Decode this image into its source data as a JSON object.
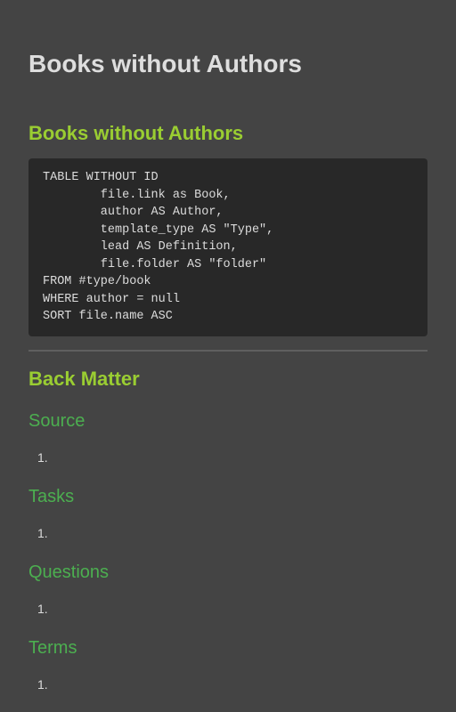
{
  "page": {
    "title": "Books without Authors"
  },
  "query_section": {
    "heading": "Books without Authors",
    "code": "TABLE WITHOUT ID\n        file.link as Book,\n        author AS Author,\n        template_type AS \"Type\",\n        lead AS Definition,\n        file.folder AS \"folder\"\nFROM #type/book\nWHERE author = null\nSORT file.name ASC"
  },
  "back_matter": {
    "heading": "Back Matter",
    "sections": [
      {
        "heading": "Source",
        "item_marker": "1."
      },
      {
        "heading": "Tasks",
        "item_marker": "1."
      },
      {
        "heading": "Questions",
        "item_marker": "1."
      },
      {
        "heading": "Terms",
        "item_marker": "1."
      }
    ]
  },
  "colors": {
    "background": "#444444",
    "code_background": "#282828",
    "h2_accent": "#9acd32",
    "h3_accent": "#4caf50",
    "text": "#dcdcdc"
  }
}
